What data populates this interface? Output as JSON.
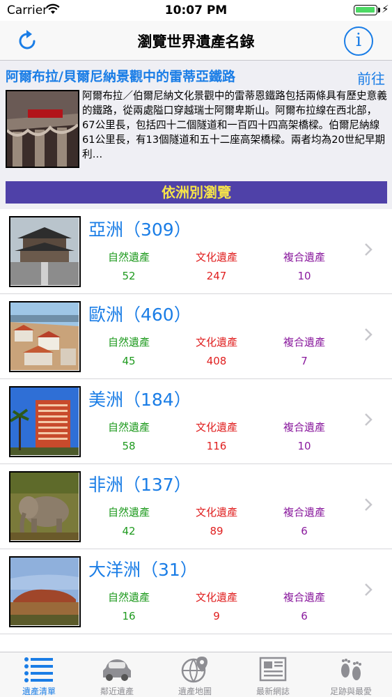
{
  "status_bar": {
    "carrier": "Carrier",
    "time": "10:07 PM"
  },
  "nav": {
    "title": "瀏覽世界遺產名錄",
    "refresh_icon": "refresh-icon",
    "info_icon": "info-icon",
    "info_glyph": "i"
  },
  "featured": {
    "title": "阿爾布拉/貝爾尼納景觀中的雷蒂亞鐵路",
    "goto_label": "前往",
    "description": "阿爾布拉／伯爾尼納文化景觀中的雷蒂恩鐵路包括兩條具有歷史意義的鐵路，從兩處隘口穿越瑞士阿爾卑斯山。阿爾布拉線在西北部，67公里長，包括四十二個隧道和一百四十四高架橋樑。伯爾尼納線61公里長，有13個隧道和五十二座高架橋樑。兩者均為20世紀早期利…",
    "browse_by_continent": "依洲別瀏覽"
  },
  "labels": {
    "natural": "自然遺產",
    "cultural": "文化遺產",
    "mixed": "複合遺產"
  },
  "continents": [
    {
      "name": "亞洲（309）",
      "natural": "52",
      "cultural": "247",
      "mixed": "10"
    },
    {
      "name": "歐洲（460）",
      "natural": "45",
      "cultural": "408",
      "mixed": "7"
    },
    {
      "name": "美洲（184）",
      "natural": "58",
      "cultural": "116",
      "mixed": "10"
    },
    {
      "name": "非洲（137）",
      "natural": "42",
      "cultural": "89",
      "mixed": "6"
    },
    {
      "name": "大洋洲（31）",
      "natural": "16",
      "cultural": "9",
      "mixed": "6"
    }
  ],
  "tabs": [
    {
      "label": "遺產清單",
      "icon": "list-icon",
      "active": true
    },
    {
      "label": "鄰近遺產",
      "icon": "car-icon",
      "active": false
    },
    {
      "label": "遺產地圖",
      "icon": "globe-pin-icon",
      "active": false
    },
    {
      "label": "最新網誌",
      "icon": "newspaper-icon",
      "active": false
    },
    {
      "label": "足跡與最愛",
      "icon": "footprints-icon",
      "active": false
    }
  ],
  "colors": {
    "accent": "#1a7de6",
    "banner_bg": "#4f41a8",
    "banner_text": "#f5e34a",
    "natural": "#1e9a1e",
    "cultural": "#e02020",
    "mixed": "#8a1b9e"
  }
}
